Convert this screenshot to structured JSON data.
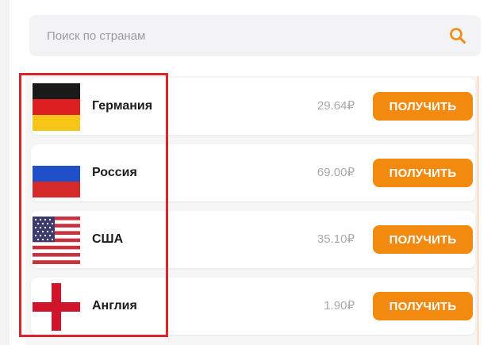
{
  "search": {
    "placeholder": "Поиск по странам",
    "icon": "search-icon",
    "icon_color": "#f28a10"
  },
  "countries": [
    {
      "name": "Германия",
      "price": "29.64₽",
      "button": "ПОЛУЧИТЬ",
      "flag_icon": "germany-flag-icon"
    },
    {
      "name": "Россия",
      "price": "69.00₽",
      "button": "ПОЛУЧИТЬ",
      "flag_icon": "russia-flag-icon"
    },
    {
      "name": "США",
      "price": "35.10₽",
      "button": "ПОЛУЧИТЬ",
      "flag_icon": "usa-flag-icon"
    },
    {
      "name": "Англия",
      "price": "1.90₽",
      "button": "ПОЛУЧИТЬ",
      "flag_icon": "england-flag-icon"
    }
  ],
  "colors": {
    "accent": "#f28a10",
    "highlight_border": "#d9262c"
  }
}
